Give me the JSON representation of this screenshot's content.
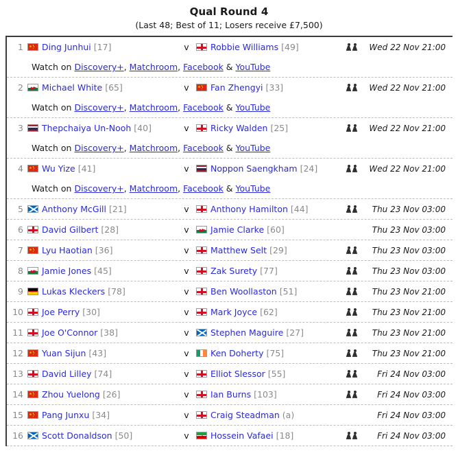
{
  "header": {
    "title": "Qual Round 4",
    "subtitle": "(Last 48; Best of 11; Losers receive £7,500)"
  },
  "labels": {
    "vs": "v",
    "watch_prefix": "Watch on",
    "comma": ",",
    "ampersand": "&"
  },
  "broadcasters": [
    {
      "name": "Discovery+"
    },
    {
      "name": "Matchroom"
    },
    {
      "name": "Facebook"
    },
    {
      "name": "YouTube"
    }
  ],
  "colors": {
    "link": "#2a2adf",
    "seed": "#8a8a8a",
    "text": "#1a1a1a",
    "separator": "#bdbdbd",
    "border": "#3c3c3c"
  },
  "matches": [
    {
      "number": "1",
      "player1": {
        "name": "Ding Junhui",
        "seed": "[17]",
        "flag": "cn",
        "flag_name": "china-flag"
      },
      "player2": {
        "name": "Robbie Williams",
        "seed": "[49]",
        "flag": "eng",
        "flag_name": "england-flag"
      },
      "date": "Wed 22 Nov 21:00",
      "crowd": true,
      "watch": true
    },
    {
      "number": "2",
      "player1": {
        "name": "Michael White",
        "seed": "[65]",
        "flag": "wal",
        "flag_name": "wales-flag"
      },
      "player2": {
        "name": "Fan Zhengyi",
        "seed": "[33]",
        "flag": "cn",
        "flag_name": "china-flag"
      },
      "date": "Wed 22 Nov 21:00",
      "crowd": true,
      "watch": true
    },
    {
      "number": "3",
      "player1": {
        "name": "Thepchaiya Un-Nooh",
        "seed": "[40]",
        "flag": "tha",
        "flag_name": "thailand-flag"
      },
      "player2": {
        "name": "Ricky Walden",
        "seed": "[25]",
        "flag": "eng",
        "flag_name": "england-flag"
      },
      "date": "Wed 22 Nov 21:00",
      "crowd": true,
      "watch": true
    },
    {
      "number": "4",
      "player1": {
        "name": "Wu Yize",
        "seed": "[41]",
        "flag": "cn",
        "flag_name": "china-flag"
      },
      "player2": {
        "name": "Noppon Saengkham",
        "seed": "[24]",
        "flag": "tha",
        "flag_name": "thailand-flag"
      },
      "date": "Wed 22 Nov 21:00",
      "crowd": true,
      "watch": true
    },
    {
      "number": "5",
      "player1": {
        "name": "Anthony McGill",
        "seed": "[21]",
        "flag": "sco",
        "flag_name": "scotland-flag"
      },
      "player2": {
        "name": "Anthony Hamilton",
        "seed": "[44]",
        "flag": "eng",
        "flag_name": "england-flag"
      },
      "date": "Thu 23 Nov 03:00",
      "crowd": true,
      "watch": false
    },
    {
      "number": "6",
      "player1": {
        "name": "David Gilbert",
        "seed": "[28]",
        "flag": "eng",
        "flag_name": "england-flag"
      },
      "player2": {
        "name": "Jamie Clarke",
        "seed": "[60]",
        "flag": "wal",
        "flag_name": "wales-flag"
      },
      "date": "Thu 23 Nov 03:00",
      "crowd": false,
      "watch": false
    },
    {
      "number": "7",
      "player1": {
        "name": "Lyu Haotian",
        "seed": "[36]",
        "flag": "cn",
        "flag_name": "china-flag"
      },
      "player2": {
        "name": "Matthew Selt",
        "seed": "[29]",
        "flag": "eng",
        "flag_name": "england-flag"
      },
      "date": "Thu 23 Nov 03:00",
      "crowd": true,
      "watch": false
    },
    {
      "number": "8",
      "player1": {
        "name": "Jamie Jones",
        "seed": "[45]",
        "flag": "wal",
        "flag_name": "wales-flag"
      },
      "player2": {
        "name": "Zak Surety",
        "seed": "[77]",
        "flag": "eng",
        "flag_name": "england-flag"
      },
      "date": "Thu 23 Nov 03:00",
      "crowd": true,
      "watch": false
    },
    {
      "number": "9",
      "player1": {
        "name": "Lukas Kleckers",
        "seed": "[78]",
        "flag": "ger",
        "flag_name": "germany-flag"
      },
      "player2": {
        "name": "Ben Woollaston",
        "seed": "[51]",
        "flag": "eng",
        "flag_name": "england-flag"
      },
      "date": "Thu 23 Nov 21:00",
      "crowd": true,
      "watch": false
    },
    {
      "number": "10",
      "player1": {
        "name": "Joe Perry",
        "seed": "[30]",
        "flag": "eng",
        "flag_name": "england-flag"
      },
      "player2": {
        "name": "Mark Joyce",
        "seed": "[62]",
        "flag": "eng",
        "flag_name": "england-flag"
      },
      "date": "Thu 23 Nov 21:00",
      "crowd": true,
      "watch": false
    },
    {
      "number": "11",
      "player1": {
        "name": "Joe O'Connor",
        "seed": "[38]",
        "flag": "eng",
        "flag_name": "england-flag"
      },
      "player2": {
        "name": "Stephen Maguire",
        "seed": "[27]",
        "flag": "sco",
        "flag_name": "scotland-flag"
      },
      "date": "Thu 23 Nov 21:00",
      "crowd": true,
      "watch": false
    },
    {
      "number": "12",
      "player1": {
        "name": "Yuan Sijun",
        "seed": "[43]",
        "flag": "cn",
        "flag_name": "china-flag"
      },
      "player2": {
        "name": "Ken Doherty",
        "seed": "[75]",
        "flag": "irl",
        "flag_name": "ireland-flag"
      },
      "date": "Thu 23 Nov 21:00",
      "crowd": true,
      "watch": false
    },
    {
      "number": "13",
      "player1": {
        "name": "David Lilley",
        "seed": "[74]",
        "flag": "eng",
        "flag_name": "england-flag"
      },
      "player2": {
        "name": "Elliot Slessor",
        "seed": "[55]",
        "flag": "eng",
        "flag_name": "england-flag"
      },
      "date": "Fri 24 Nov 03:00",
      "crowd": true,
      "watch": false
    },
    {
      "number": "14",
      "player1": {
        "name": "Zhou Yuelong",
        "seed": "[26]",
        "flag": "cn",
        "flag_name": "china-flag"
      },
      "player2": {
        "name": "Ian Burns",
        "seed": "[103]",
        "flag": "eng",
        "flag_name": "england-flag"
      },
      "date": "Fri 24 Nov 03:00",
      "crowd": true,
      "watch": false
    },
    {
      "number": "15",
      "player1": {
        "name": "Pang Junxu",
        "seed": "[34]",
        "flag": "cn",
        "flag_name": "china-flag"
      },
      "player2": {
        "name": "Craig Steadman",
        "seed": "(a)",
        "flag": "eng",
        "flag_name": "england-flag"
      },
      "date": "Fri 24 Nov 03:00",
      "crowd": false,
      "watch": false
    },
    {
      "number": "16",
      "player1": {
        "name": "Scott Donaldson",
        "seed": "[50]",
        "flag": "sco",
        "flag_name": "scotland-flag"
      },
      "player2": {
        "name": "Hossein Vafaei",
        "seed": "[18]",
        "flag": "irn",
        "flag_name": "iran-flag"
      },
      "date": "Fri 24 Nov 03:00",
      "crowd": true,
      "watch": false
    }
  ]
}
